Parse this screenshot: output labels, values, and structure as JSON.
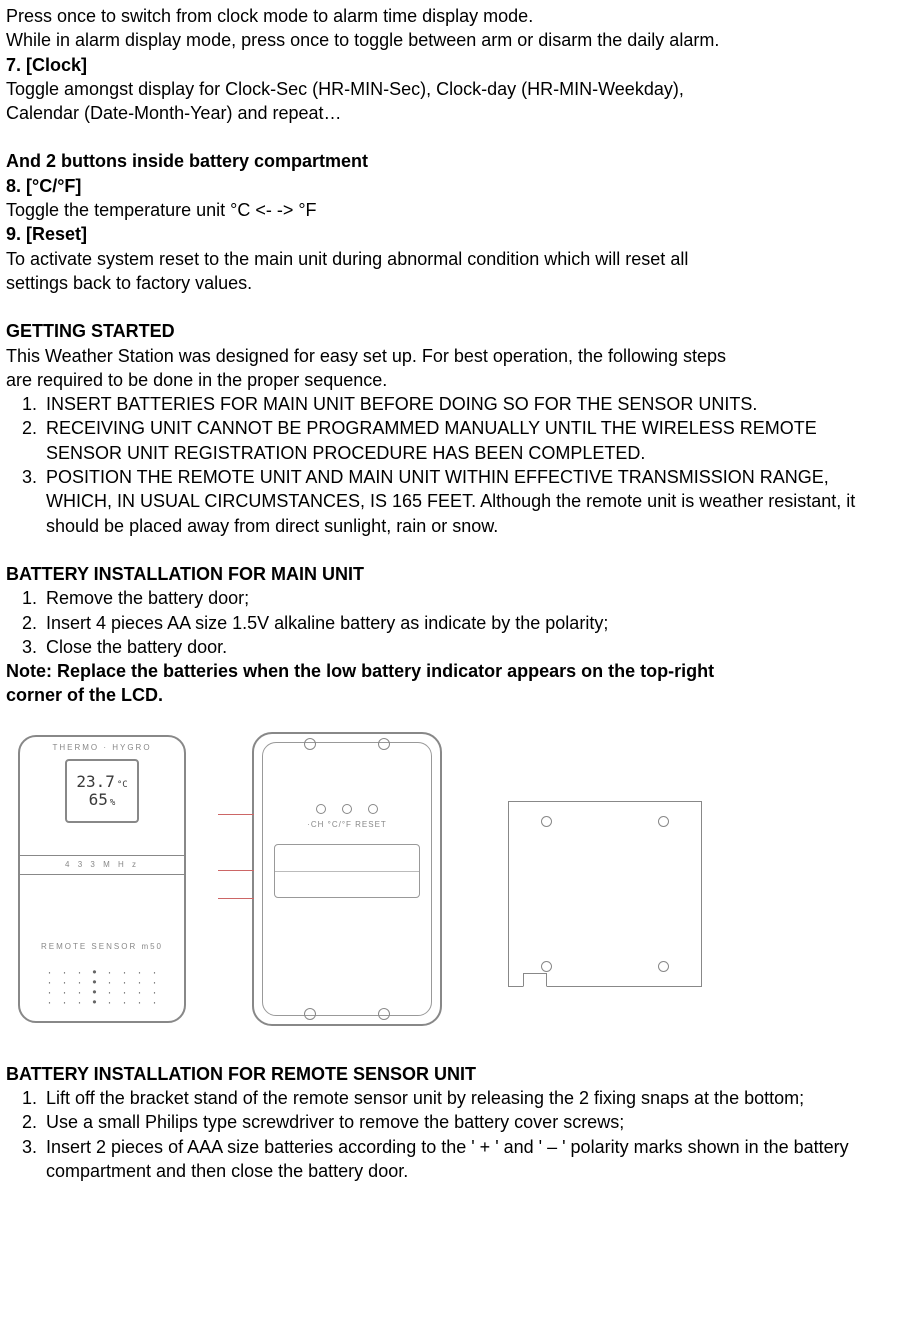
{
  "intro_lines": [
    "Press once to switch from clock mode to alarm time display mode.",
    "While in alarm display mode, press once to toggle between arm or disarm the daily alarm."
  ],
  "item7": {
    "heading": "7. [Clock]",
    "lines": [
      "Toggle amongst display for Clock-Sec (HR-MIN-Sec), Clock-day (HR-MIN-Weekday),",
      "Calendar (Date-Month-Year) and repeat…"
    ]
  },
  "compartment_heading": "And 2 buttons inside battery compartment",
  "item8": {
    "heading": "8. [°C/°F]",
    "line": "Toggle the temperature unit °C <- -> °F"
  },
  "item9": {
    "heading": "9. [Reset]",
    "lines": [
      "To activate system reset to the main unit during abnormal condition which will reset all",
      "settings back to factory values."
    ]
  },
  "getting_started": {
    "heading": "GETTING STARTED",
    "intro": [
      "This Weather Station was designed for easy set up. For best operation, the following steps",
      "are required to be done in the proper sequence."
    ],
    "steps": [
      "INSERT BATTERIES FOR MAIN UNIT BEFORE DOING SO FOR THE SENSOR UNITS.",
      "RECEIVING UNIT CANNOT BE PROGRAMMED MANUALLY UNTIL THE WIRELESS REMOTE SENSOR UNIT REGISTRATION PROCEDURE HAS BEEN COMPLETED.",
      "POSITION THE REMOTE UNIT AND MAIN UNIT WITHIN EFFECTIVE TRANSMISSION RANGE, WHICH, IN USUAL CIRCUMSTANCES, IS 165 FEET. Although the remote unit is weather resistant, it should be placed away from direct sunlight, rain or snow."
    ]
  },
  "battery_main": {
    "heading": "BATTERY INSTALLATION FOR MAIN UNIT",
    "steps": [
      "Remove the battery door;",
      "Insert 4 pieces AA size 1.5V alkaline battery as indicate by the polarity;",
      "Close the battery door."
    ],
    "note": [
      "Note: Replace the batteries when the low battery indicator appears on the top-right",
      "corner of the LCD."
    ]
  },
  "figure": {
    "top_label": "THERMO · HYGRO",
    "temp": "23.7",
    "temp_unit": "°C",
    "hum": "65",
    "hum_unit": "%",
    "band": "4 3 3 M H z",
    "brand": "REMOTE SENSOR m50",
    "ctrl_labels": "·CH  °C/°F  RESET"
  },
  "battery_remote": {
    "heading": "BATTERY INSTALLATION FOR REMOTE SENSOR UNIT",
    "steps": [
      "Lift off the bracket stand of the remote sensor unit by releasing the 2 fixing snaps at the bottom;",
      "Use a small Philips type screwdriver to remove the battery cover screws;",
      "Insert 2 pieces of AAA size batteries according to the ' + ' and ' – ' polarity marks shown in the battery compartment and then close the battery door."
    ]
  }
}
